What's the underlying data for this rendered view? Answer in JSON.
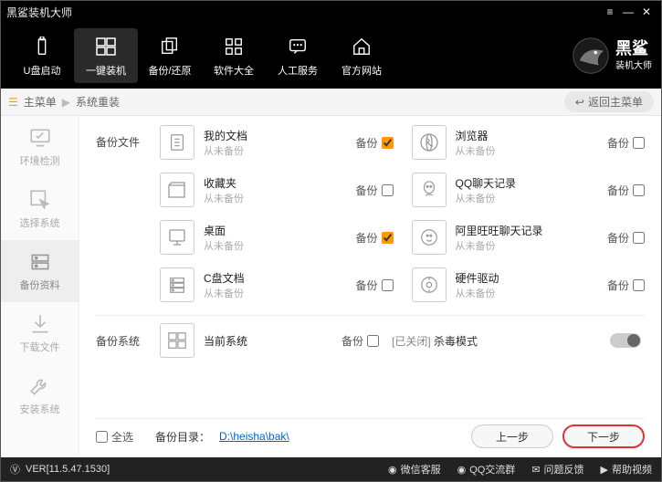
{
  "title": "黑鲨装机大师",
  "brand": {
    "name": "黑鲨",
    "sub": "装机大师"
  },
  "topnav": [
    {
      "id": "usb",
      "label": "U盘启动"
    },
    {
      "id": "oneclick",
      "label": "一键装机",
      "active": true
    },
    {
      "id": "backup",
      "label": "备份/还原"
    },
    {
      "id": "apps",
      "label": "软件大全"
    },
    {
      "id": "support",
      "label": "人工服务"
    },
    {
      "id": "site",
      "label": "官方网站"
    }
  ],
  "crumb": {
    "root": "主菜单",
    "current": "系统重装",
    "back": "返回主菜单"
  },
  "sidebar": [
    {
      "id": "detect",
      "label": "环境检测"
    },
    {
      "id": "select",
      "label": "选择系统"
    },
    {
      "id": "backupdata",
      "label": "备份资料",
      "active": true
    },
    {
      "id": "download",
      "label": "下载文件"
    },
    {
      "id": "install",
      "label": "安装系统"
    }
  ],
  "section_files": "备份文件",
  "section_system": "备份系统",
  "chk_label": "备份",
  "entries": [
    {
      "title": "我的文档",
      "sub": "从未备份",
      "checked": true
    },
    {
      "title": "浏览器",
      "sub": "从未备份",
      "checked": false
    },
    {
      "title": "收藏夹",
      "sub": "从未备份",
      "checked": false
    },
    {
      "title": "QQ聊天记录",
      "sub": "从未备份",
      "checked": false
    },
    {
      "title": "桌面",
      "sub": "从未备份",
      "checked": true
    },
    {
      "title": "阿里旺旺聊天记录",
      "sub": "从未备份",
      "checked": false
    },
    {
      "title": "C盘文档",
      "sub": "从未备份",
      "checked": false
    },
    {
      "title": "硬件驱动",
      "sub": "从未备份",
      "checked": false
    }
  ],
  "system_entry": {
    "title": "当前系统",
    "checked": false
  },
  "kill": {
    "prefix": "[已关闭]",
    "label": "杀毒模式"
  },
  "select_all": "全选",
  "backup_dir_label": "备份目录：",
  "backup_dir": "D:\\heisha\\bak\\",
  "btn_prev": "上一步",
  "btn_next": "下一步",
  "status": {
    "version": "VER[11.5.47.1530]",
    "links": [
      "微信客服",
      "QQ交流群",
      "问题反馈",
      "帮助视频"
    ]
  }
}
